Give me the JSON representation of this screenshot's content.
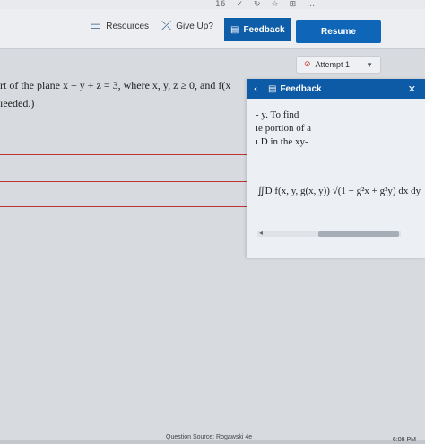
{
  "browser": {
    "icons": [
      "16",
      "✓",
      "↻",
      "☆",
      "⊞",
      "…"
    ]
  },
  "toolbar": {
    "resources_label": "Resources",
    "give_up_label": "Give Up?",
    "feedback_label": "Feedback",
    "resume_label": "Resume"
  },
  "attempt": {
    "label": "Attempt 1"
  },
  "question": {
    "line1": "rt of the plane x + y + z = 3, where x, y, z ≥ 0, and f(x",
    "line2": "ıeeded.)"
  },
  "feedback_panel": {
    "title": "Feedback",
    "lines": [
      "- y. To find",
      "ıe portion of a",
      "ı D in the xy-"
    ],
    "formula": "∬D f(x, y, g(x, y)) √(1 + g²x + g²y) dx dy"
  },
  "footer": {
    "source": "Question Source: Rogawski 4e",
    "clock": "6:09 PM"
  },
  "colors": {
    "accent": "#0e5da8",
    "attempt_icon": "#c0392b"
  }
}
